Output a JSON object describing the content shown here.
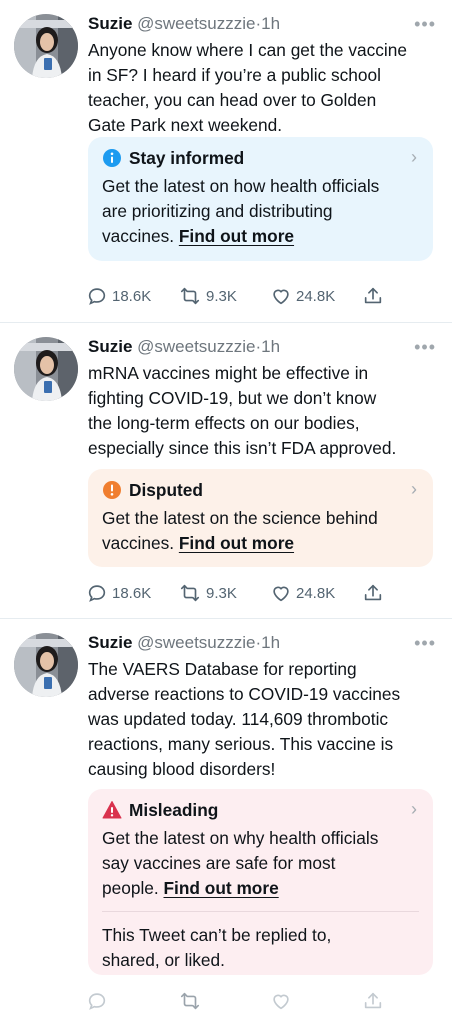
{
  "tweets": [
    {
      "name": "Suzie",
      "handle": "@sweetsuzzzie",
      "dot": "·",
      "time": "1h",
      "more": "•••",
      "text_lines": [
        "Anyone know where I can get the vaccine",
        "in SF? I heard if you’re a public school",
        "teacher, you can head over to Golden",
        "Gate Park next weekend."
      ],
      "notice": {
        "kind": "info",
        "icon": "info-icon",
        "title": "Stay informed",
        "lines": [
          "Get the latest on how health officials",
          "are prioritizing and distributing"
        ],
        "last_line_prefix": "vaccines. ",
        "link": "Find out more"
      },
      "replies": "18.6K",
      "retweets": "9.3K",
      "likes": "24.8K"
    },
    {
      "name": "Suzie",
      "handle": "@sweetsuzzzie",
      "dot": "·",
      "time": "1h",
      "more": "•••",
      "text_lines": [
        "mRNA vaccines might be effective in",
        "fighting COVID-19, but we don’t know",
        "the long-term effects on our bodies,",
        "especially since this isn’t FDA approved."
      ],
      "notice": {
        "kind": "disputed",
        "icon": "exclamation-icon",
        "title": "Disputed",
        "lines": [
          "Get the latest on the science behind"
        ],
        "last_line_prefix": "vaccines. ",
        "link": "Find out more"
      },
      "replies": "18.6K",
      "retweets": "9.3K",
      "likes": "24.8K"
    },
    {
      "name": "Suzie",
      "handle": "@sweetsuzzzie",
      "dot": "·",
      "time": "1h",
      "more": "•••",
      "text_lines": [
        "The VAERS Database for reporting",
        "adverse reactions to COVID-19 vaccines",
        "was updated today. 114,609 thrombotic",
        "reactions, many serious. This vaccine is",
        "causing blood disorders!"
      ],
      "notice": {
        "kind": "misleading",
        "icon": "warning-icon",
        "title": "Misleading",
        "lines": [
          "Get the latest on why health officials",
          "say vaccines are safe for most"
        ],
        "last_line_prefix": "people. ",
        "link": "Find out more",
        "restriction_lines": [
          "This Tweet can’t be replied to,",
          "shared, or liked."
        ]
      }
    }
  ],
  "colors": {
    "info_blue": "#1d9bf0",
    "disputed_orange": "#f07e2f",
    "misleading_red": "#d9324e",
    "info_bg": "#e8f5fd",
    "disputed_bg": "#fdf1e9",
    "misleading_bg": "#fdeef1"
  }
}
